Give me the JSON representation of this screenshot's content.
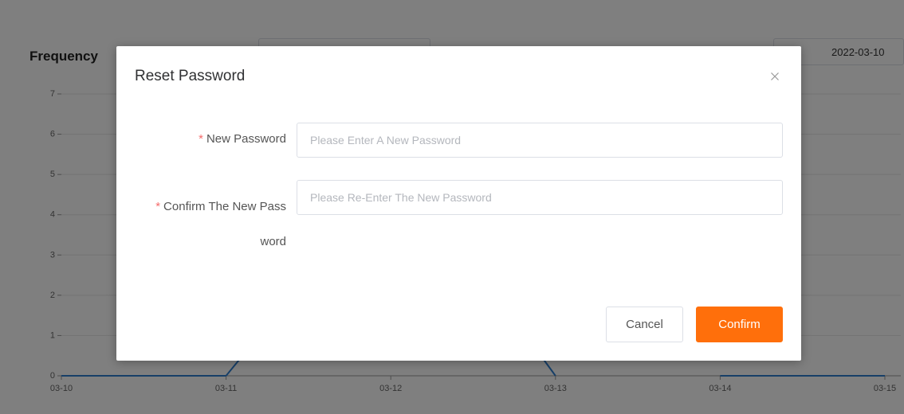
{
  "background": {
    "chart_title": "Frequency",
    "date_filter": "2022-03-10",
    "chart_data": {
      "type": "line",
      "x": [
        "03-10",
        "03-11",
        "03-12",
        "03-13",
        "03-14",
        "03-15"
      ],
      "y_ticks": [
        "0",
        "1",
        "2",
        "3",
        "4",
        "5",
        "6",
        "7"
      ],
      "ylim": [
        0,
        7
      ],
      "series": [
        {
          "values": [
            0,
            0,
            null,
            null,
            0,
            0
          ]
        }
      ],
      "grid": true,
      "line_color": "#2f7fd0"
    }
  },
  "dialog": {
    "title": "Reset Password",
    "close_icon": "close-icon",
    "fields": {
      "new_password": {
        "required_mark": "*",
        "label": "New Password",
        "value": "",
        "placeholder": "Please Enter A New Password"
      },
      "confirm_password": {
        "required_mark": "*",
        "label_line1": "Confirm The New Pass",
        "label_line2": "word",
        "value": "",
        "placeholder": "Please Re-Enter The New Password"
      }
    },
    "buttons": {
      "cancel": "Cancel",
      "confirm": "Confirm"
    },
    "colors": {
      "primary": "#ff6f0b",
      "required": "#f56c6c",
      "overlay": "rgba(0,0,0,0.5)"
    }
  }
}
